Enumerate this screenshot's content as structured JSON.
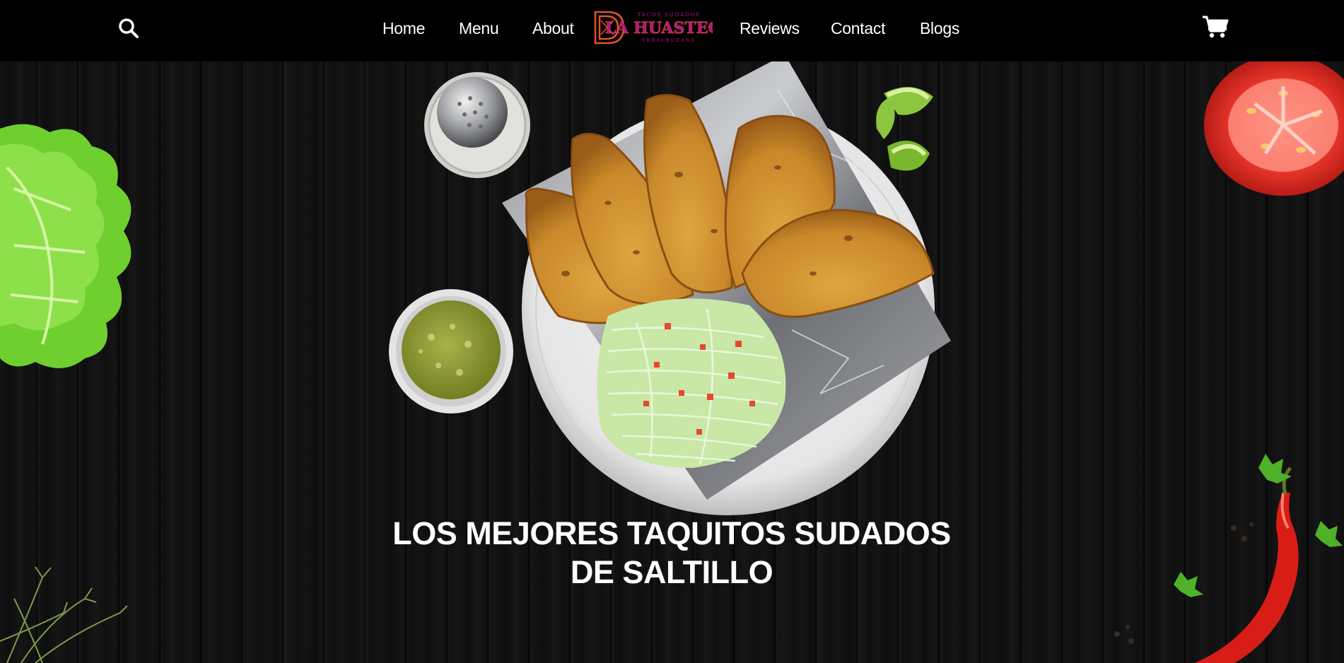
{
  "header": {
    "search_icon": "search-icon",
    "cart_icon": "cart-icon",
    "nav": [
      {
        "label": "Home"
      },
      {
        "label": "Menu"
      },
      {
        "label": "About"
      },
      {
        "label": "Reviews"
      },
      {
        "label": "Contact"
      },
      {
        "label": "Blogs"
      }
    ],
    "logo": {
      "top_text": "TACOS SUDADOS",
      "main_text": "LA HUASTECA",
      "bottom_text": "VERACRUZANA",
      "color_main": "#b0158c",
      "color_mark": "#e2532a"
    }
  },
  "hero": {
    "headline_line1": "LOS MEJORES TAQUITOS SUDADOS",
    "headline_line2": "DE SALTILLO"
  },
  "colors": {
    "header_bg": "#000000",
    "hero_bg": "#111111",
    "text": "#ffffff"
  }
}
